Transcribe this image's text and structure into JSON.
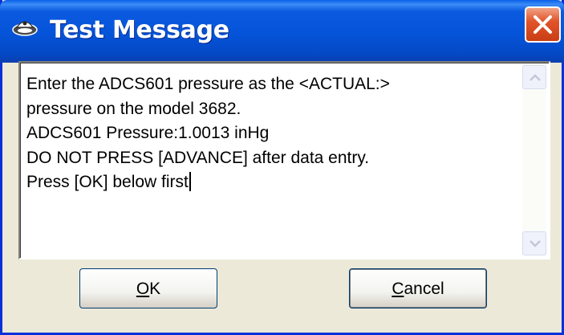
{
  "window": {
    "title": "Test Message"
  },
  "message": {
    "lines": [
      "Enter the ADCS601 pressure as the <ACTUAL:>",
      "pressure on the model 3682.",
      "ADCS601 Pressure:1.0013 inHg",
      "DO NOT PRESS [ADVANCE] after data entry.",
      "Press [OK] below first"
    ]
  },
  "buttons": {
    "ok_mnemonic": "O",
    "ok_rest": "K",
    "cancel_mnemonic": "C",
    "cancel_rest": "ancel"
  },
  "icons": {
    "app": "app-icon",
    "close": "close-icon",
    "scroll_up": "scroll-up-arrow-icon",
    "scroll_down": "scroll-down-arrow-icon"
  },
  "colors": {
    "titlebar": "#0553d8",
    "close_button": "#e2542a",
    "dialog_background": "#ece9d8",
    "button_border": "#003c74"
  }
}
